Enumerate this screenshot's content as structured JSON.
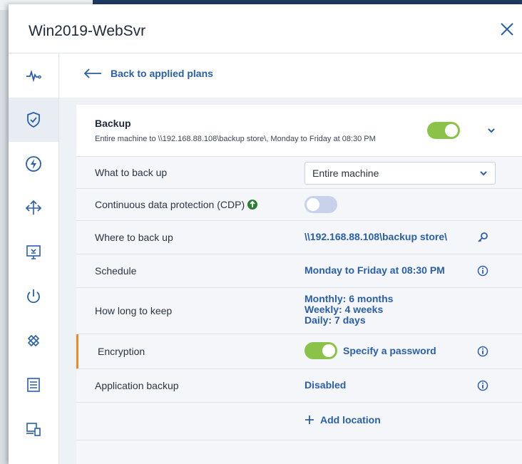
{
  "window": {
    "title": "Win2019-WebSvr"
  },
  "sidebar": {
    "items": [
      {
        "icon": "pulse-icon"
      },
      {
        "icon": "shield-check-icon",
        "active": true
      },
      {
        "icon": "lightning-icon"
      },
      {
        "icon": "share-arrows-icon"
      },
      {
        "icon": "remote-desktop-icon"
      },
      {
        "icon": "power-icon"
      },
      {
        "icon": "bandage-icon"
      },
      {
        "icon": "report-icon"
      },
      {
        "icon": "devices-icon"
      }
    ]
  },
  "nav": {
    "back_label": "Back to applied plans"
  },
  "backup": {
    "title": "Backup",
    "subtitle": "Entire machine to \\\\192.168.88.108\\backup store\\, Monday to Friday at 08:30 PM",
    "enabled": true
  },
  "rows": {
    "what": {
      "label": "What to back up",
      "value": "Entire machine"
    },
    "cdp": {
      "label": "Continuous data protection (CDP)",
      "enabled": false
    },
    "where": {
      "label": "Where to back up",
      "value": "\\\\192.168.88.108\\backup store\\"
    },
    "schedule": {
      "label": "Schedule",
      "value": "Monday to Friday at 08:30 PM"
    },
    "retention": {
      "label": "How long to keep",
      "monthly": "Monthly: 6 months",
      "weekly": "Weekly: 4 weeks",
      "daily": "Daily: 7 days"
    },
    "encryption": {
      "label": "Encryption",
      "value": "Specify a password",
      "enabled": true
    },
    "app_backup": {
      "label": "Application backup",
      "value": "Disabled"
    }
  },
  "add_location": {
    "label": "Add location"
  },
  "colors": {
    "accent": "#2a5fa8",
    "toggle_on": "#8bc34a",
    "toggle_off": "#c8d2ea",
    "highlight": "#f08a24"
  }
}
